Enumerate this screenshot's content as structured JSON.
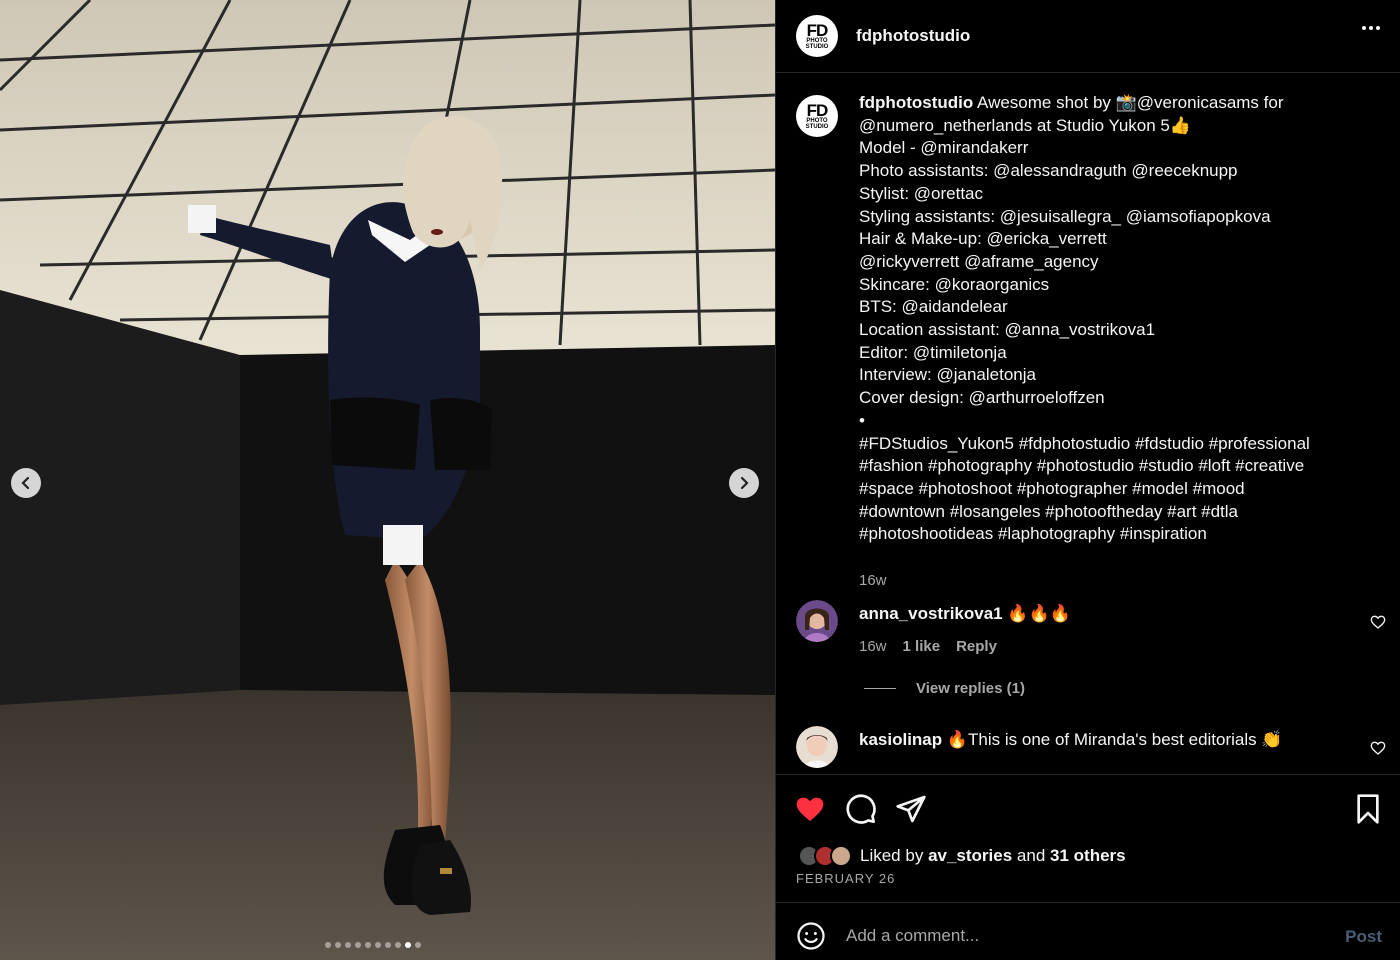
{
  "post": {
    "username": "fdphotostudio",
    "avatar_text": {
      "big": "FD",
      "small": "PHOTO STUDIO"
    },
    "photo_description": "",
    "carousel": {
      "total": 10,
      "active_index": 8
    }
  },
  "caption": {
    "username": "fdphotostudio",
    "lines": [
      "Awesome shot by 📸@veronicasams for",
      "@numero_netherlands at Studio Yukon 5👍",
      "Model - @mirandakerr",
      "Photo assistants: @alessandraguth @reeceknupp",
      "Stylist: @orettac",
      "Styling assistants: @jesuisallegra_ @iamsofiapopkova",
      "Hair & Make-up: @ericka_verrett",
      "@rickyverrett @aframe_agency",
      "Skincare: @koraorganics",
      "BTS: @aidandelear",
      "Location assistant: @anna_vostrikova1",
      "Editor: @timiletonja",
      "Interview: @janaletonja",
      "Cover design: @arthurroeloffzen",
      "•",
      "#FDStudios_Yukon5 #fdphotostudio #fdstudio #professional",
      "#fashion #photography #photostudio #studio #loft #creative",
      "#space #photoshoot #photographer #model #mood",
      "#downtown #losangeles #photooftheday #art #dtla",
      "#photoshootideas #laphotography #inspiration"
    ],
    "time": "16w"
  },
  "comments": [
    {
      "username": "anna_vostrikova1",
      "text": "🔥🔥🔥",
      "time": "16w",
      "likes": "1 like",
      "reply": "Reply",
      "view_replies": "View replies (1)"
    },
    {
      "username": "kasiolinap",
      "text": "🔥This is one of Miranda's best editorials 👏"
    }
  ],
  "actions": {
    "liked_prefix": "Liked by",
    "liked_user": "av_stories",
    "liked_and": "and",
    "liked_others": "31 others",
    "date": "FEBRUARY 26",
    "like_color": "#ff3040"
  },
  "add_comment": {
    "placeholder": "Add a comment...",
    "post_label": "Post"
  }
}
